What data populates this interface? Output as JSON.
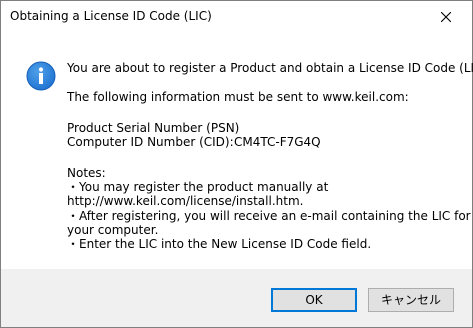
{
  "window": {
    "title": "Obtaining a License ID Code (LIC)"
  },
  "icons": {
    "info": "info-icon",
    "close": "close-icon"
  },
  "message": {
    "line1": "You are about to register a Product and obtain a License ID Code (LIC).",
    "line2": "The following information must be sent to www.keil.com:",
    "psn_label": "Product Serial Number (PSN)",
    "cid_label": "Computer ID Number (CID):",
    "cid_value": "CM4TC-F7G4Q",
    "notes_heading": "Notes:",
    "note1_a": "・You may register the product manually at",
    "note1_b": "http://www.keil.com/license/install.htm.",
    "note2_a": "・After registering, you will receive an e-mail containing the LIC for",
    "note2_b": "your computer.",
    "note3": "・Enter the LIC into the New License ID Code field."
  },
  "buttons": {
    "ok": "OK",
    "cancel": "キャンセル"
  },
  "colors": {
    "info_icon": "#1e73d2",
    "default_button_border": "#0078d7",
    "footer_background": "#f0f0f0"
  }
}
